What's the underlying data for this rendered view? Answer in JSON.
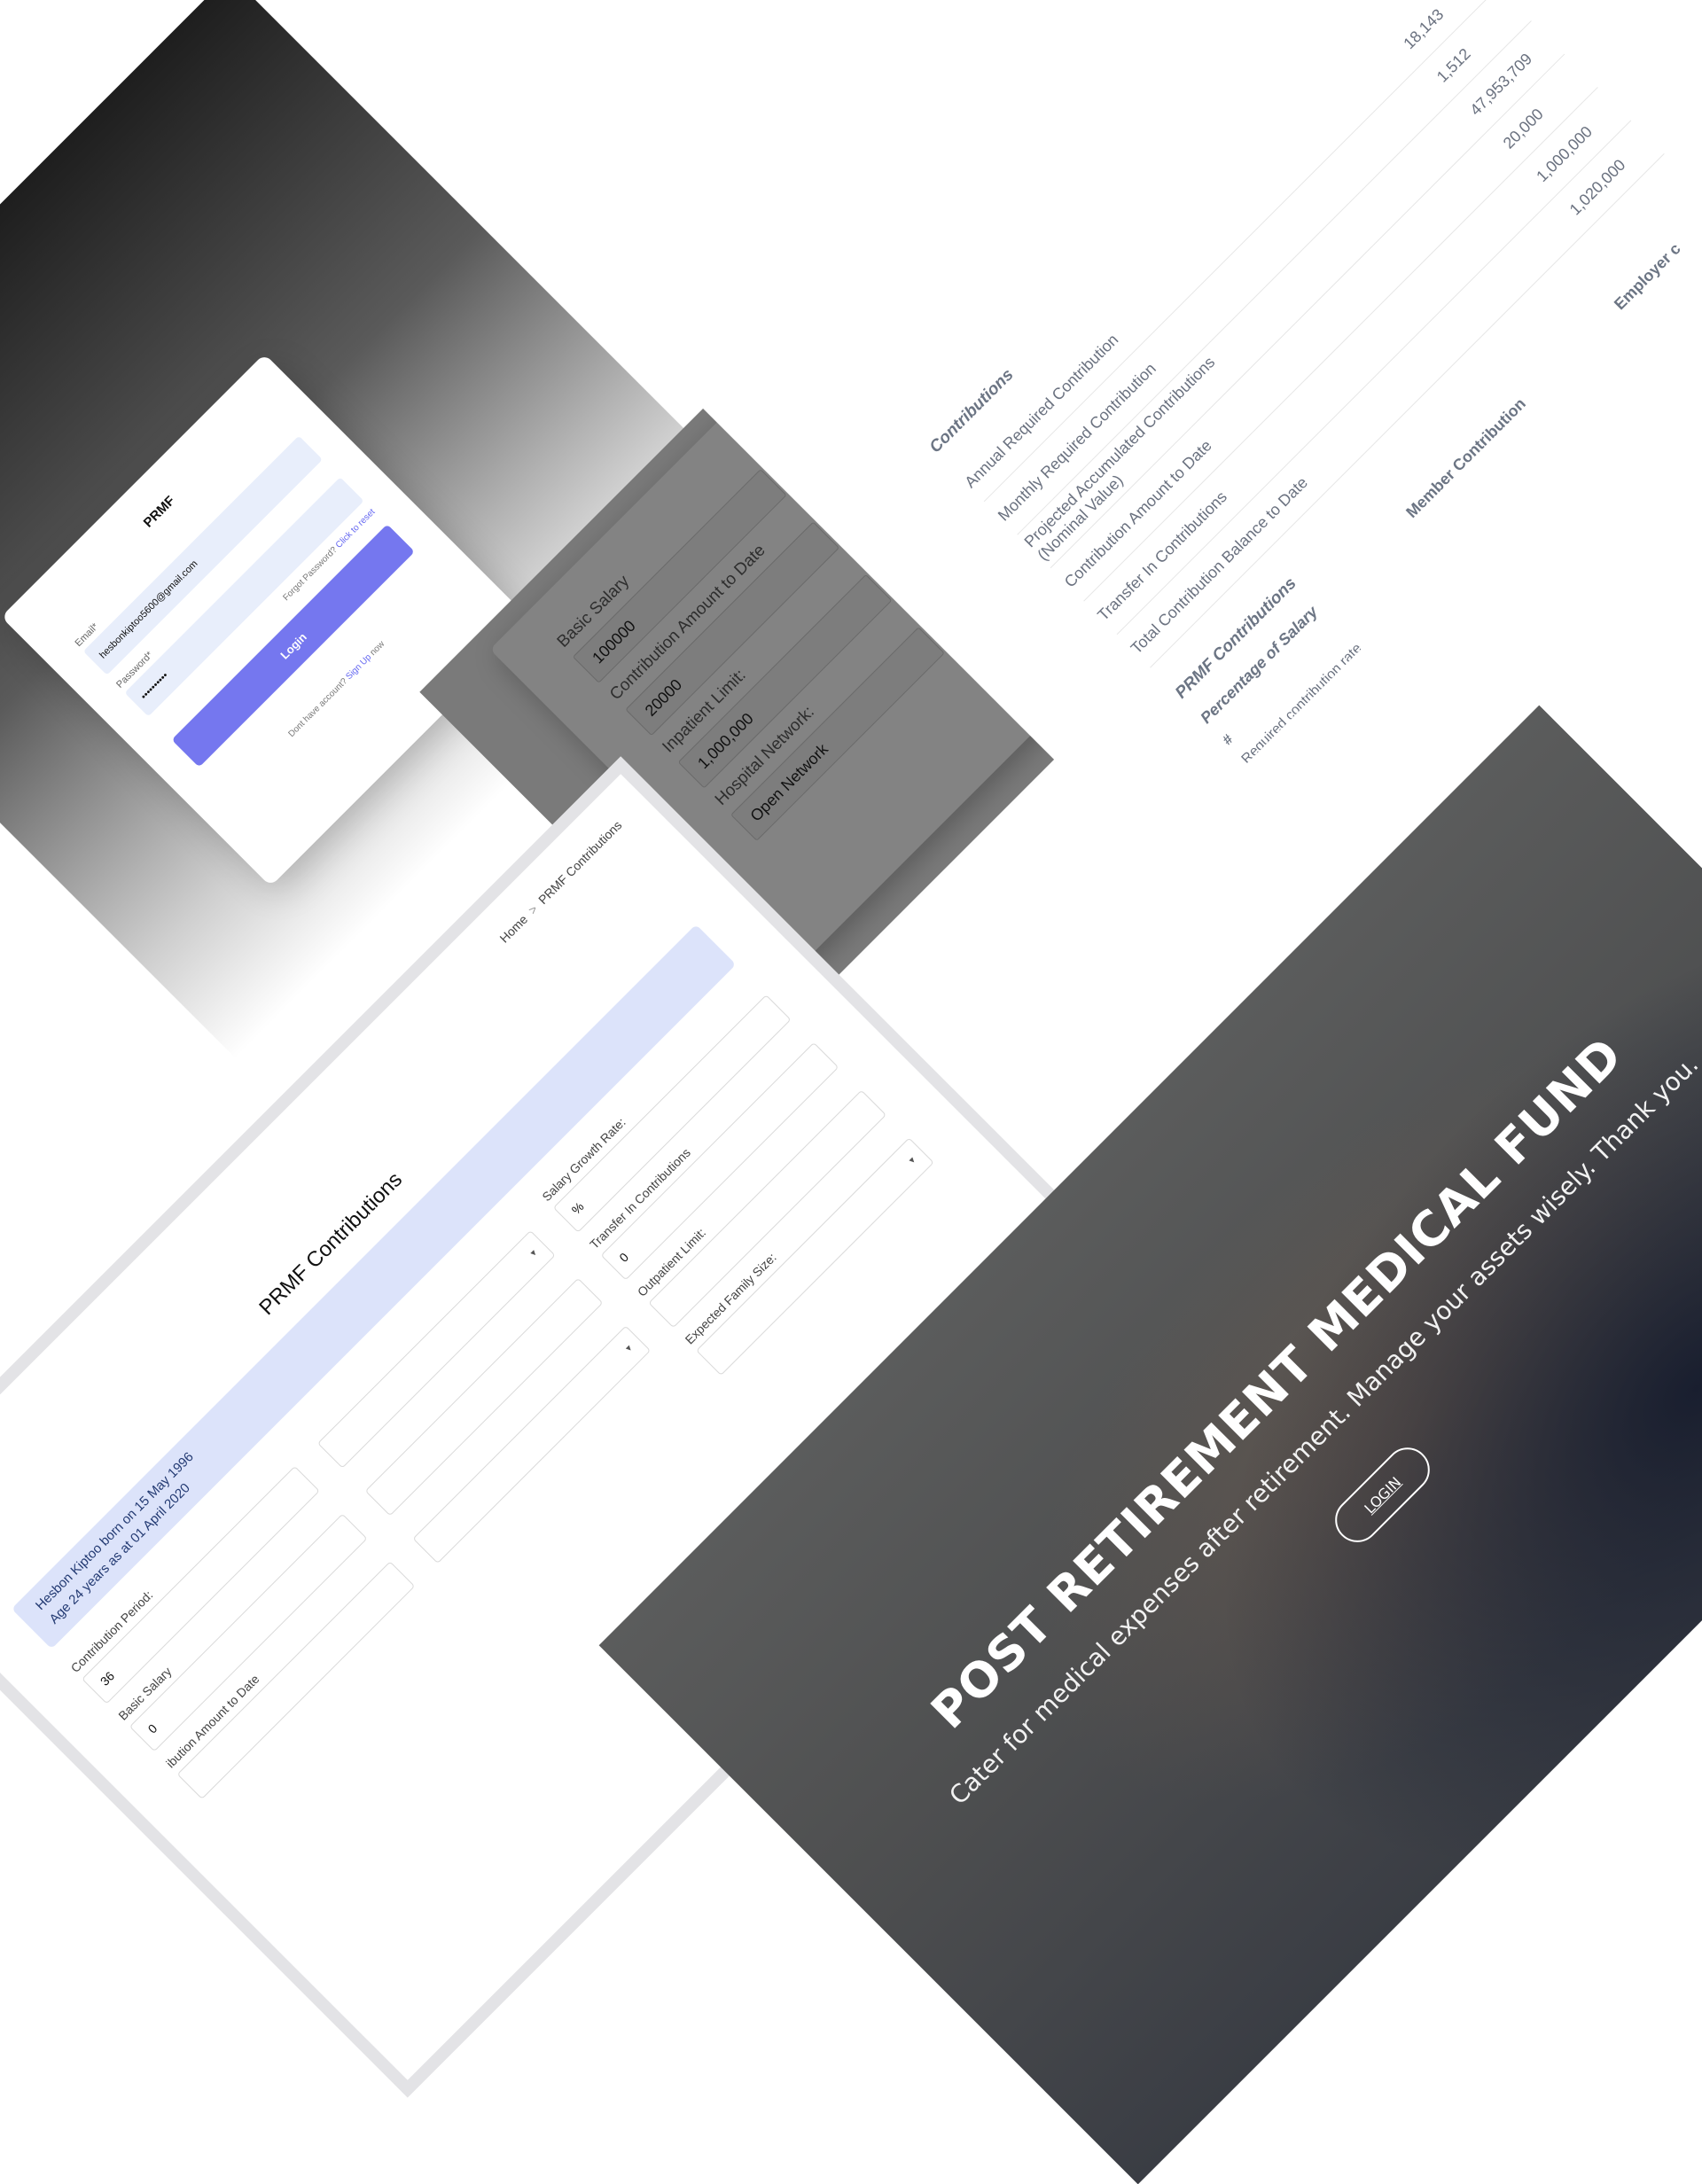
{
  "login": {
    "brand": "PRMF",
    "email_label": "Email*",
    "email_value": "hesbonkiptoo5600@gmail.com",
    "password_label": "Password*",
    "password_value": "••••••••••",
    "forgot_text": "Forgot Password?",
    "forgot_link": "Click to reset",
    "login_button": "Login",
    "signup_text": "Dont have account?",
    "signup_link": "Sign Up",
    "signup_suffix": "now"
  },
  "modal": {
    "basic_salary_label": "Basic Salary",
    "basic_salary_value": "100000",
    "contribution_label": "Contribution Amount to Date",
    "contribution_value": "20000",
    "inpatient_label": "Inpatient Limit:",
    "inpatient_value": "1,000,000",
    "hospital_label": "Hospital Network:",
    "hospital_value": "Open Network"
  },
  "summary": {
    "heading": "Contributions",
    "rows": [
      {
        "label": "Annual Required Contribution",
        "value": "18,143"
      },
      {
        "label": "Monthly Required Contribution",
        "value": "1,512"
      },
      {
        "label": "Projected Accumulated Contributions (Nominal Value)",
        "value": "47,953,709"
      },
      {
        "label": "Contribution Amount to Date",
        "value": "20,000"
      },
      {
        "label": "Transfer In Contributions",
        "value": "1,000,000"
      },
      {
        "label": "Total Contribution Balance to Date",
        "value": "1,020,000"
      }
    ],
    "prmf_heading": "PRMF Contributions",
    "pct_heading": "Percentage of Salary",
    "member_heading": "Member Contribution",
    "employer_heading": "Employer c",
    "hash": "#",
    "cut_row": "Required contribution rate"
  },
  "form": {
    "breadcrumb_home": "Home",
    "breadcrumb_current": "PRMF Contributions",
    "title": "PRMF Contributions",
    "info_line1": "Hesbon Kiptoo born on 15 May 1996",
    "info_line2": "Age 24 years as at 01 April 2020",
    "contribution_period_label": "Contribution Period:",
    "contribution_period_value": "36",
    "salary_growth_label": "Salary Growth Rate:",
    "salary_growth_value": "%",
    "basic_salary_label": "Basic Salary",
    "basic_salary_value": "0",
    "transfer_label": "Transfer In Contributions",
    "transfer_value": "0",
    "contribution_amount_label": "ibution Amount to Date",
    "outpatient_label": "Outpatient Limit:",
    "family_size_label": "Expected Family Size:"
  },
  "hero": {
    "title": "POST RETIREMENT MEDICAL FUND",
    "subtitle": "Cater for medical expenses after retirement. Manage your assets wisely. Thank you.",
    "login_button": "LOGIN"
  }
}
